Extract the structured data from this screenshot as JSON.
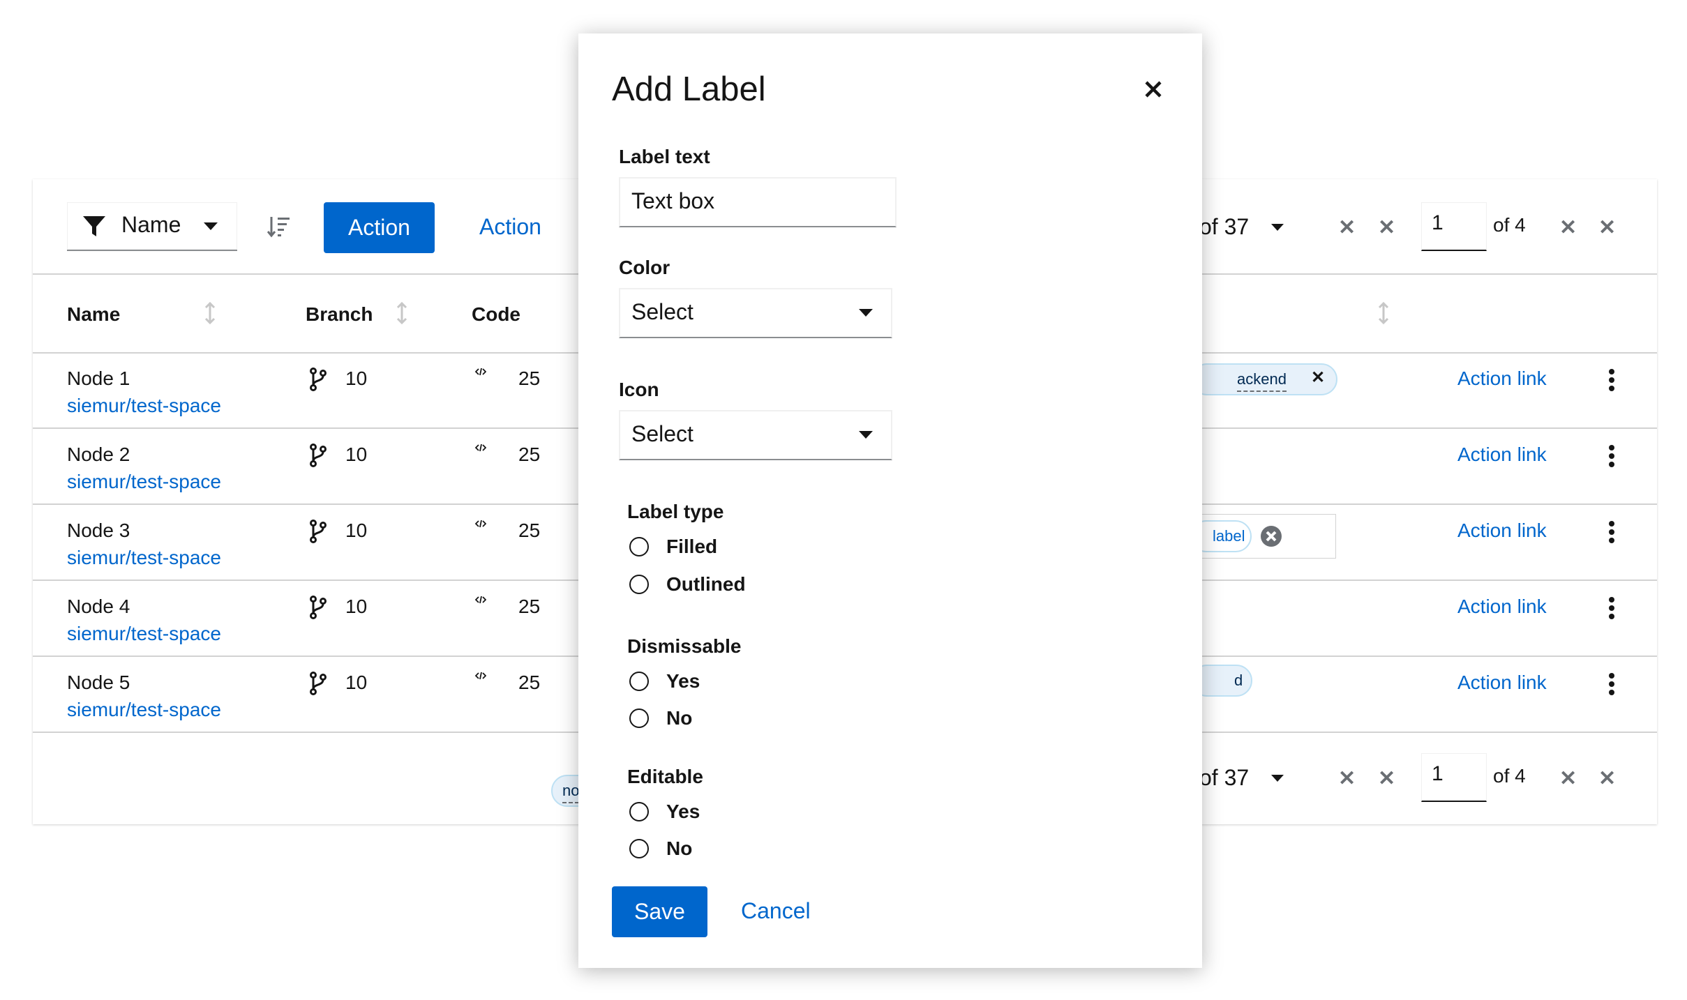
{
  "toolbar": {
    "filter_label": "Name",
    "action_button": "Action",
    "action_link": "Action",
    "pagination_count": "of 37",
    "page_value": "1",
    "page_of": "of 4"
  },
  "table": {
    "headers": {
      "name": "Name",
      "branch": "Branch",
      "code": "Code"
    },
    "rows": [
      {
        "name": "Node 1",
        "repo": "siemur/test-space",
        "branches": "10",
        "code": "25",
        "action": "Action link"
      },
      {
        "name": "Node 2",
        "repo": "siemur/test-space",
        "branches": "10",
        "code": "25",
        "action": "Action link"
      },
      {
        "name": "Node 3",
        "repo": "siemur/test-space",
        "branches": "10",
        "code": "25",
        "action": "Action link"
      },
      {
        "name": "Node 4",
        "repo": "siemur/test-space",
        "branches": "10",
        "code": "25",
        "action": "Action link"
      },
      {
        "name": "Node 5",
        "repo": "siemur/test-space",
        "branches": "10",
        "code": "25",
        "action": "Action link"
      }
    ],
    "label_fragments": {
      "row1": "ackend",
      "row3": "label",
      "row5": "d",
      "footer": "no"
    }
  },
  "footer": {
    "pagination_count": "of 37",
    "page_value": "1",
    "page_of": "of 4"
  },
  "modal": {
    "title": "Add Label",
    "label_text_label": "Label text",
    "label_text_value": "Text box",
    "color_label": "Color",
    "color_value": "Select",
    "icon_label": "Icon",
    "icon_value": "Select",
    "label_type_label": "Label type",
    "label_type_options": [
      "Filled",
      "Outlined"
    ],
    "dismissable_label": "Dismissable",
    "dismissable_options": [
      "Yes",
      "No"
    ],
    "editable_label": "Editable",
    "editable_options": [
      "Yes",
      "No"
    ],
    "save_button": "Save",
    "cancel_button": "Cancel"
  },
  "colors": {
    "primary": "#0066cc",
    "text": "#151515",
    "border": "#d2d2d2",
    "label_bg": "#e7f1fa",
    "icon_gray": "#6a6e73"
  }
}
